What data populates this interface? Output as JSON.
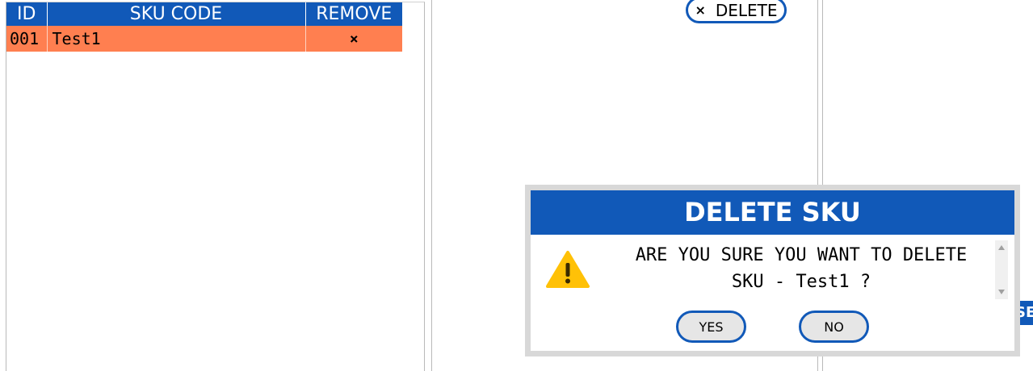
{
  "table": {
    "headers": {
      "id": "ID",
      "sku_code": "SKU CODE",
      "remove": "REMOVE"
    },
    "rows": [
      {
        "id": "001",
        "sku_code": "Test1",
        "remove_icon": "×"
      }
    ]
  },
  "toolbar": {
    "delete_icon": "×",
    "delete_label": "DELETE"
  },
  "edge_chip": {
    "label": "SE"
  },
  "dialog": {
    "title": "DELETE SKU",
    "message_line1": "ARE YOU SURE YOU WANT TO DELETE",
    "message_line2": "SKU - Test1 ?",
    "yes_label": "YES",
    "no_label": "NO",
    "icon": "warning-icon"
  },
  "colors": {
    "accent": "#1159b8",
    "row_selected": "#ff7f50",
    "warning": "#ffc107"
  }
}
